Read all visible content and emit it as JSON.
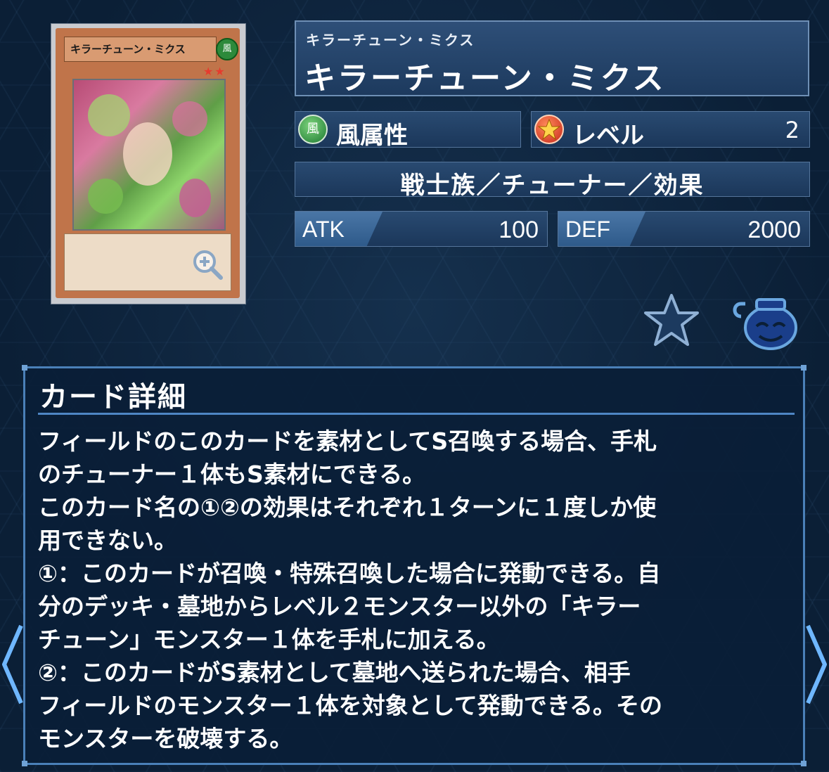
{
  "card_image": {
    "name": "キラーチューン・ミクス",
    "attribute_glyph": "風",
    "stars": "★★"
  },
  "card": {
    "ruby": "キラーチューン・ミクス",
    "name": "キラーチューン・ミクス",
    "attribute": "風属性",
    "level_label": "レベル",
    "level": "2",
    "type": "戦士族／チューナー／効果",
    "atk_label": "ATK",
    "atk": "100",
    "def_label": "DEF",
    "def": "2000"
  },
  "icons": {
    "zoom": "zoom-in-icon",
    "favorite": "star-icon",
    "pot": "pot-of-greed-icon",
    "prev": "chevron-left-icon",
    "next": "chevron-right-icon"
  },
  "detail": {
    "title": "カード詳細",
    "lines": [
      "フィールドのこのカードを素材としてS召喚する場合、手札",
      "のチューナー１体もS素材にできる。",
      "このカード名の①②の効果はそれぞれ１ターンに１度しか使",
      "用できない。",
      "①：このカードが召喚・特殊召喚した場合に発動できる。自",
      "分のデッキ・墓地からレベル２モンスター以外の「キラー",
      "チューン」モンスター１体を手札に加える。",
      "②：このカードがS素材として墓地へ送られた場合、相手",
      "フィールドのモンスター１体を対象として発動できる。その",
      "モンスターを破壊する。"
    ]
  },
  "colors": {
    "background": "#0b1f36",
    "panel_border": "#4a80b8",
    "accent": "#6e8fb5"
  }
}
